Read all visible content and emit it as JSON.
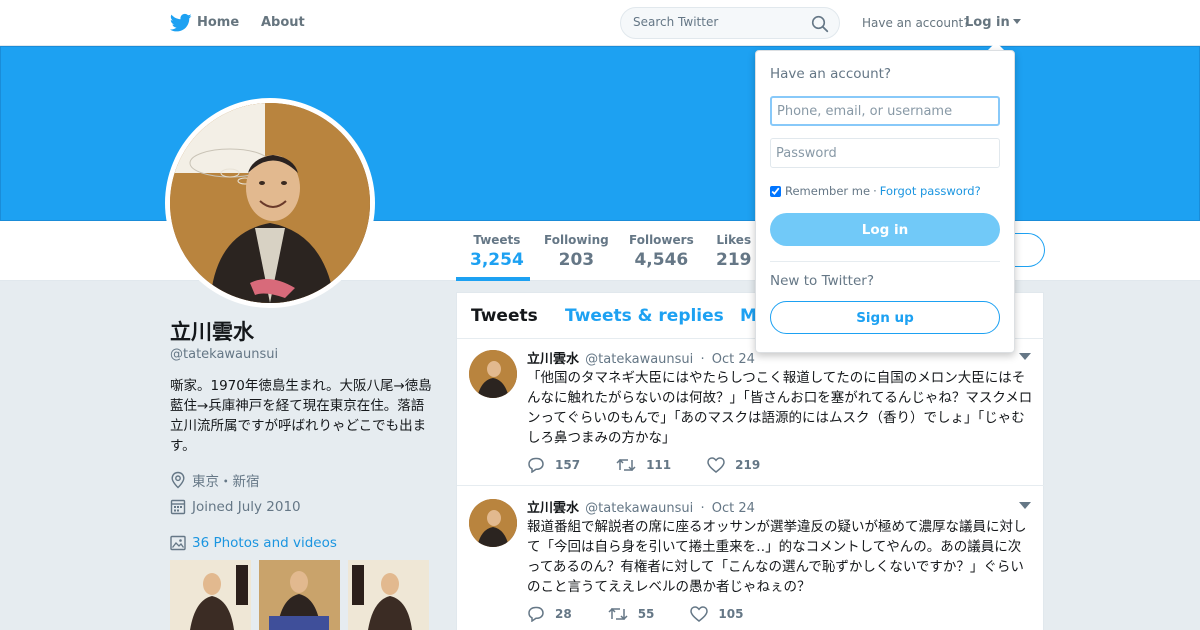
{
  "nav": {
    "home": "Home",
    "about": "About",
    "search_placeholder": "Search Twitter",
    "have_account": "Have an account?",
    "login": "Log in"
  },
  "profile": {
    "name": "立川雲水",
    "handle": "@tatekawaunsui",
    "bio": "噺家。1970年徳島生まれ。大阪八尾→徳島藍住→兵庫神戸を経て現在東京在住。落語立川流所属ですが呼ばれりゃどこでも出ます。",
    "location": "東京・新宿",
    "joined": "Joined July 2010",
    "photos": "36 Photos and videos"
  },
  "stats": [
    {
      "label": "Tweets",
      "value": "3,254"
    },
    {
      "label": "Following",
      "value": "203"
    },
    {
      "label": "Followers",
      "value": "4,546"
    },
    {
      "label": "Likes",
      "value": "219"
    }
  ],
  "timeline": {
    "tabs": [
      "Tweets",
      "Tweets & replies",
      "M"
    ],
    "tweets": [
      {
        "author": "立川雲水",
        "handle": "@tatekawaunsui",
        "time": "Oct 24",
        "text": "「他国のタマネギ大臣にはやたらしつこく報道してたのに自国のメロン大臣にはそんなに触れたがらないのは何故？」「皆さんお口を塞がれてるんじゃね？マスクメロンってぐらいのもんで」「あのマスクは語源的にはムスク（香り）でしょ」「じゃむしろ鼻つまみの方かな」",
        "replies": "157",
        "retweets": "111",
        "likes": "219"
      },
      {
        "author": "立川雲水",
        "handle": "@tatekawaunsui",
        "time": "Oct 24",
        "text": "報道番組で解説者の席に座るオッサンが選挙違反の疑いが極めて濃厚な議員に対して「今回は自ら身を引いて捲土重来を‥」的なコメントしてやんの。あの議員に次ってあるのん？有権者に対して「こんなの選んで恥ずかしくないですか？」ぐらいのこと言うてええレベルの愚か者じゃねぇの？",
        "replies": "28",
        "retweets": "55",
        "likes": "105"
      }
    ]
  },
  "login_dropdown": {
    "title": "Have an account?",
    "username_placeholder": "Phone, email, or username",
    "password_placeholder": "Password",
    "remember": "Remember me",
    "separator": "·",
    "forgot": "Forgot password?",
    "login_button": "Log in",
    "new_to_twitter": "New to Twitter?",
    "signup_button": "Sign up"
  },
  "colors": {
    "brand_blue": "#1da1f2",
    "link_blue": "#1b95e0",
    "background": "#e6ecf0"
  }
}
